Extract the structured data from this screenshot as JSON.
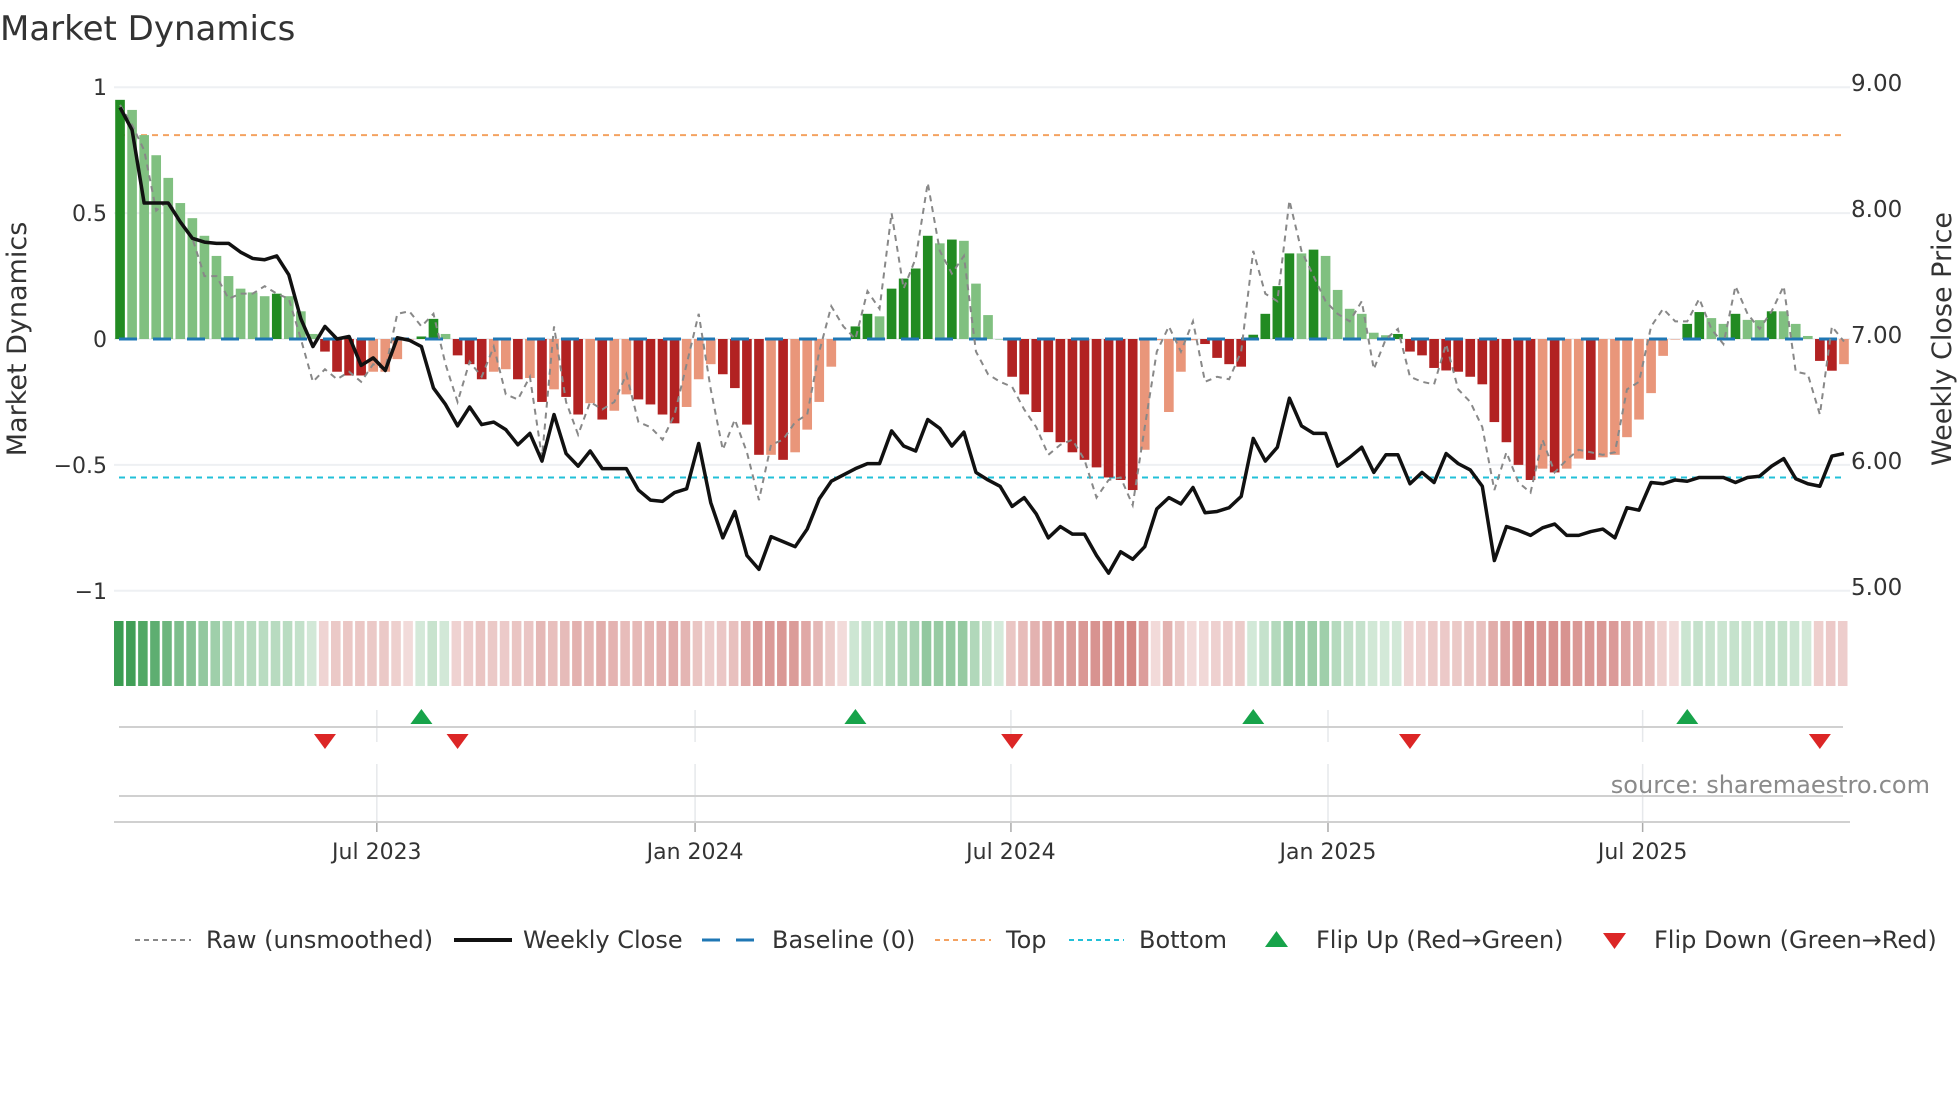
{
  "chart_data": {
    "type": "bar",
    "title": "Market Dynamics",
    "ylabel": "Market Dynamics",
    "y2label": "Weekly Close Price",
    "ylim": [
      -1,
      1
    ],
    "y2lim": [
      5,
      9
    ],
    "y_ticks": [
      "1",
      "0.5",
      "0",
      "−0.5",
      "−1"
    ],
    "y_tick_values": [
      1,
      0.5,
      0,
      -0.5,
      -1
    ],
    "y2_ticks": [
      "9.00",
      "8.00",
      "7.00",
      "6.00",
      "5.00"
    ],
    "y2_tick_values": [
      9,
      8,
      7,
      6,
      5
    ],
    "x_ticks": [
      {
        "label": "Jul 2023",
        "week": 21.8
      },
      {
        "label": "Jan 2024",
        "week": 48.2
      },
      {
        "label": "Jul 2024",
        "week": 74.4
      },
      {
        "label": "Jan 2025",
        "week": 100.7
      },
      {
        "label": "Jul 2025",
        "week": 126.8
      }
    ],
    "top_level": 0.81,
    "bottom_level": -0.55,
    "baseline": 0,
    "source": "source: sharemaestro.com",
    "colors": {
      "up_strong": "#228b22",
      "up_weak": "#80c080",
      "down_strong": "#b22222",
      "down_weak": "#e9967a",
      "raw": "#888888",
      "close": "#111111",
      "baseline": "#1f77b4",
      "top": "#f4a261",
      "bottom": "#22c0d8",
      "flip_up": "#17a34a",
      "flip_down": "#dc2626",
      "heat_green": "#2e9646",
      "heat_red": "#be4b46"
    },
    "bar_shade": "DLLLLLLLLLLLLDLLLRRRRPPPPDDLRRRPPRPRPRRPRPPRRRRPPPRRRRPRPPPPPDDLDDDDLDLLLLRRRRRRRRRRRPPPPPRRRRDDDDLDLLLLLLDRRRRRRRRRRRPRPPRPPPPPPPDDLLDLLDLLLRRP",
    "smoothed": [
      0.95,
      0.91,
      0.81,
      0.73,
      0.64,
      0.54,
      0.48,
      0.41,
      0.33,
      0.25,
      0.2,
      0.185,
      0.17,
      0.18,
      0.17,
      0.11,
      0.02,
      -0.05,
      -0.13,
      -0.145,
      -0.145,
      -0.13,
      -0.13,
      -0.08,
      0,
      0.01,
      0.08,
      0.02,
      -0.065,
      -0.1,
      -0.16,
      -0.13,
      -0.12,
      -0.16,
      -0.155,
      -0.25,
      -0.2,
      -0.23,
      -0.3,
      -0.255,
      -0.32,
      -0.285,
      -0.22,
      -0.24,
      -0.26,
      -0.3,
      -0.335,
      -0.27,
      -0.16,
      -0.1,
      -0.14,
      -0.195,
      -0.34,
      -0.46,
      -0.46,
      -0.48,
      -0.45,
      -0.36,
      -0.25,
      -0.11,
      0,
      0.05,
      0.1,
      0.09,
      0.2,
      0.24,
      0.28,
      0.41,
      0.38,
      0.395,
      0.39,
      0.22,
      0.095,
      0,
      -0.15,
      -0.22,
      -0.29,
      -0.37,
      -0.41,
      -0.45,
      -0.48,
      -0.51,
      -0.55,
      -0.56,
      -0.6,
      -0.44,
      -0.005,
      -0.29,
      -0.13,
      -0.005,
      -0.02,
      -0.075,
      -0.1,
      -0.11,
      0.017,
      0.1,
      0.21,
      0.34,
      0.34,
      0.355,
      0.33,
      0.195,
      0.12,
      0.1,
      0.025,
      0.015,
      0.02,
      -0.05,
      -0.065,
      -0.115,
      -0.125,
      -0.13,
      -0.15,
      -0.18,
      -0.33,
      -0.41,
      -0.5,
      -0.56,
      -0.515,
      -0.53,
      -0.515,
      -0.475,
      -0.48,
      -0.47,
      -0.46,
      -0.39,
      -0.32,
      -0.215,
      -0.067,
      0,
      0.06,
      0.107,
      0.083,
      0.06,
      0.1,
      0.076,
      0.075,
      0.11,
      0.11,
      0.06,
      0.012,
      -0.087,
      -0.126,
      -0.1
    ],
    "raw": [
      0.93,
      0.85,
      0.75,
      0.51,
      0.55,
      0.47,
      0.4,
      0.25,
      0.25,
      0.16,
      0.18,
      0.18,
      0.21,
      0.18,
      0.16,
      0.0,
      -0.17,
      -0.12,
      -0.16,
      -0.13,
      -0.17,
      -0.1,
      -0.12,
      0.1,
      0.11,
      0.05,
      0.1,
      -0.1,
      -0.25,
      -0.09,
      -0.15,
      -0.03,
      -0.22,
      -0.24,
      -0.15,
      -0.47,
      0.05,
      -0.25,
      -0.38,
      -0.25,
      -0.28,
      -0.25,
      -0.14,
      -0.33,
      -0.35,
      -0.4,
      -0.3,
      -0.1,
      0.1,
      -0.2,
      -0.44,
      -0.32,
      -0.45,
      -0.64,
      -0.42,
      -0.4,
      -0.33,
      -0.3,
      -0.05,
      0.13,
      0.05,
      0.0,
      0.19,
      0.12,
      0.5,
      0.2,
      0.32,
      0.62,
      0.35,
      0.26,
      0.33,
      -0.05,
      -0.14,
      -0.17,
      -0.19,
      -0.28,
      -0.35,
      -0.46,
      -0.42,
      -0.4,
      -0.48,
      -0.63,
      -0.56,
      -0.55,
      -0.66,
      -0.35,
      -0.05,
      0.05,
      -0.05,
      0.07,
      -0.17,
      -0.15,
      -0.16,
      -0.05,
      0.35,
      0.18,
      0.15,
      0.55,
      0.35,
      0.25,
      0.15,
      0.1,
      0.07,
      0.15,
      -0.12,
      0.0,
      0.04,
      -0.15,
      -0.17,
      -0.18,
      -0.02,
      -0.2,
      -0.25,
      -0.35,
      -0.6,
      -0.45,
      -0.57,
      -0.61,
      -0.4,
      -0.53,
      -0.48,
      -0.44,
      -0.45,
      -0.46,
      -0.45,
      -0.2,
      -0.17,
      0.05,
      0.12,
      0.07,
      0.07,
      0.16,
      0.04,
      -0.02,
      0.21,
      0.1,
      0.04,
      0.11,
      0.21,
      -0.13,
      -0.14,
      -0.3,
      0.05,
      -0.01
    ],
    "close": [
      8.84,
      8.66,
      8.08,
      8.08,
      8.08,
      7.93,
      7.8,
      7.77,
      7.76,
      7.76,
      7.69,
      7.64,
      7.63,
      7.66,
      7.51,
      7.16,
      6.94,
      7.1,
      7.0,
      7.02,
      6.79,
      6.85,
      6.75,
      7.01,
      6.99,
      6.94,
      6.61,
      6.48,
      6.31,
      6.46,
      6.32,
      6.34,
      6.28,
      6.16,
      6.25,
      6.03,
      6.4,
      6.09,
      5.99,
      6.11,
      5.97,
      5.97,
      5.97,
      5.8,
      5.72,
      5.71,
      5.78,
      5.81,
      6.17,
      5.7,
      5.42,
      5.63,
      5.28,
      5.17,
      5.43,
      5.39,
      5.35,
      5.49,
      5.73,
      5.87,
      5.92,
      5.97,
      6.01,
      6.01,
      6.27,
      6.15,
      6.11,
      6.36,
      6.29,
      6.15,
      6.26,
      5.94,
      5.88,
      5.83,
      5.67,
      5.74,
      5.61,
      5.42,
      5.51,
      5.45,
      5.45,
      5.28,
      5.14,
      5.31,
      5.25,
      5.35,
      5.65,
      5.74,
      5.69,
      5.82,
      5.62,
      5.63,
      5.66,
      5.75,
      6.21,
      6.03,
      6.14,
      6.53,
      6.31,
      6.25,
      6.25,
      5.99,
      6.06,
      6.14,
      5.94,
      6.08,
      6.08,
      5.85,
      5.94,
      5.86,
      6.09,
      6.01,
      5.96,
      5.83,
      5.24,
      5.51,
      5.48,
      5.44,
      5.5,
      5.53,
      5.44,
      5.44,
      5.47,
      5.49,
      5.42,
      5.66,
      5.64,
      5.86,
      5.85,
      5.88,
      5.87,
      5.9,
      5.9,
      5.9,
      5.86,
      5.9,
      5.91,
      5.99,
      6.05,
      5.89,
      5.85,
      5.83,
      6.07,
      6.09
    ],
    "flip_up_weeks": [
      25,
      61,
      94,
      130
    ],
    "flip_down_weeks": [
      17,
      28,
      74,
      107,
      141
    ],
    "legend": {
      "placement": "bottom",
      "items": [
        "Raw (unsmoothed)",
        "Weekly Close",
        "Baseline (0)",
        "Top",
        "Bottom",
        "Flip Up (Red→Green)",
        "Flip Down (Green→Red)"
      ]
    }
  }
}
